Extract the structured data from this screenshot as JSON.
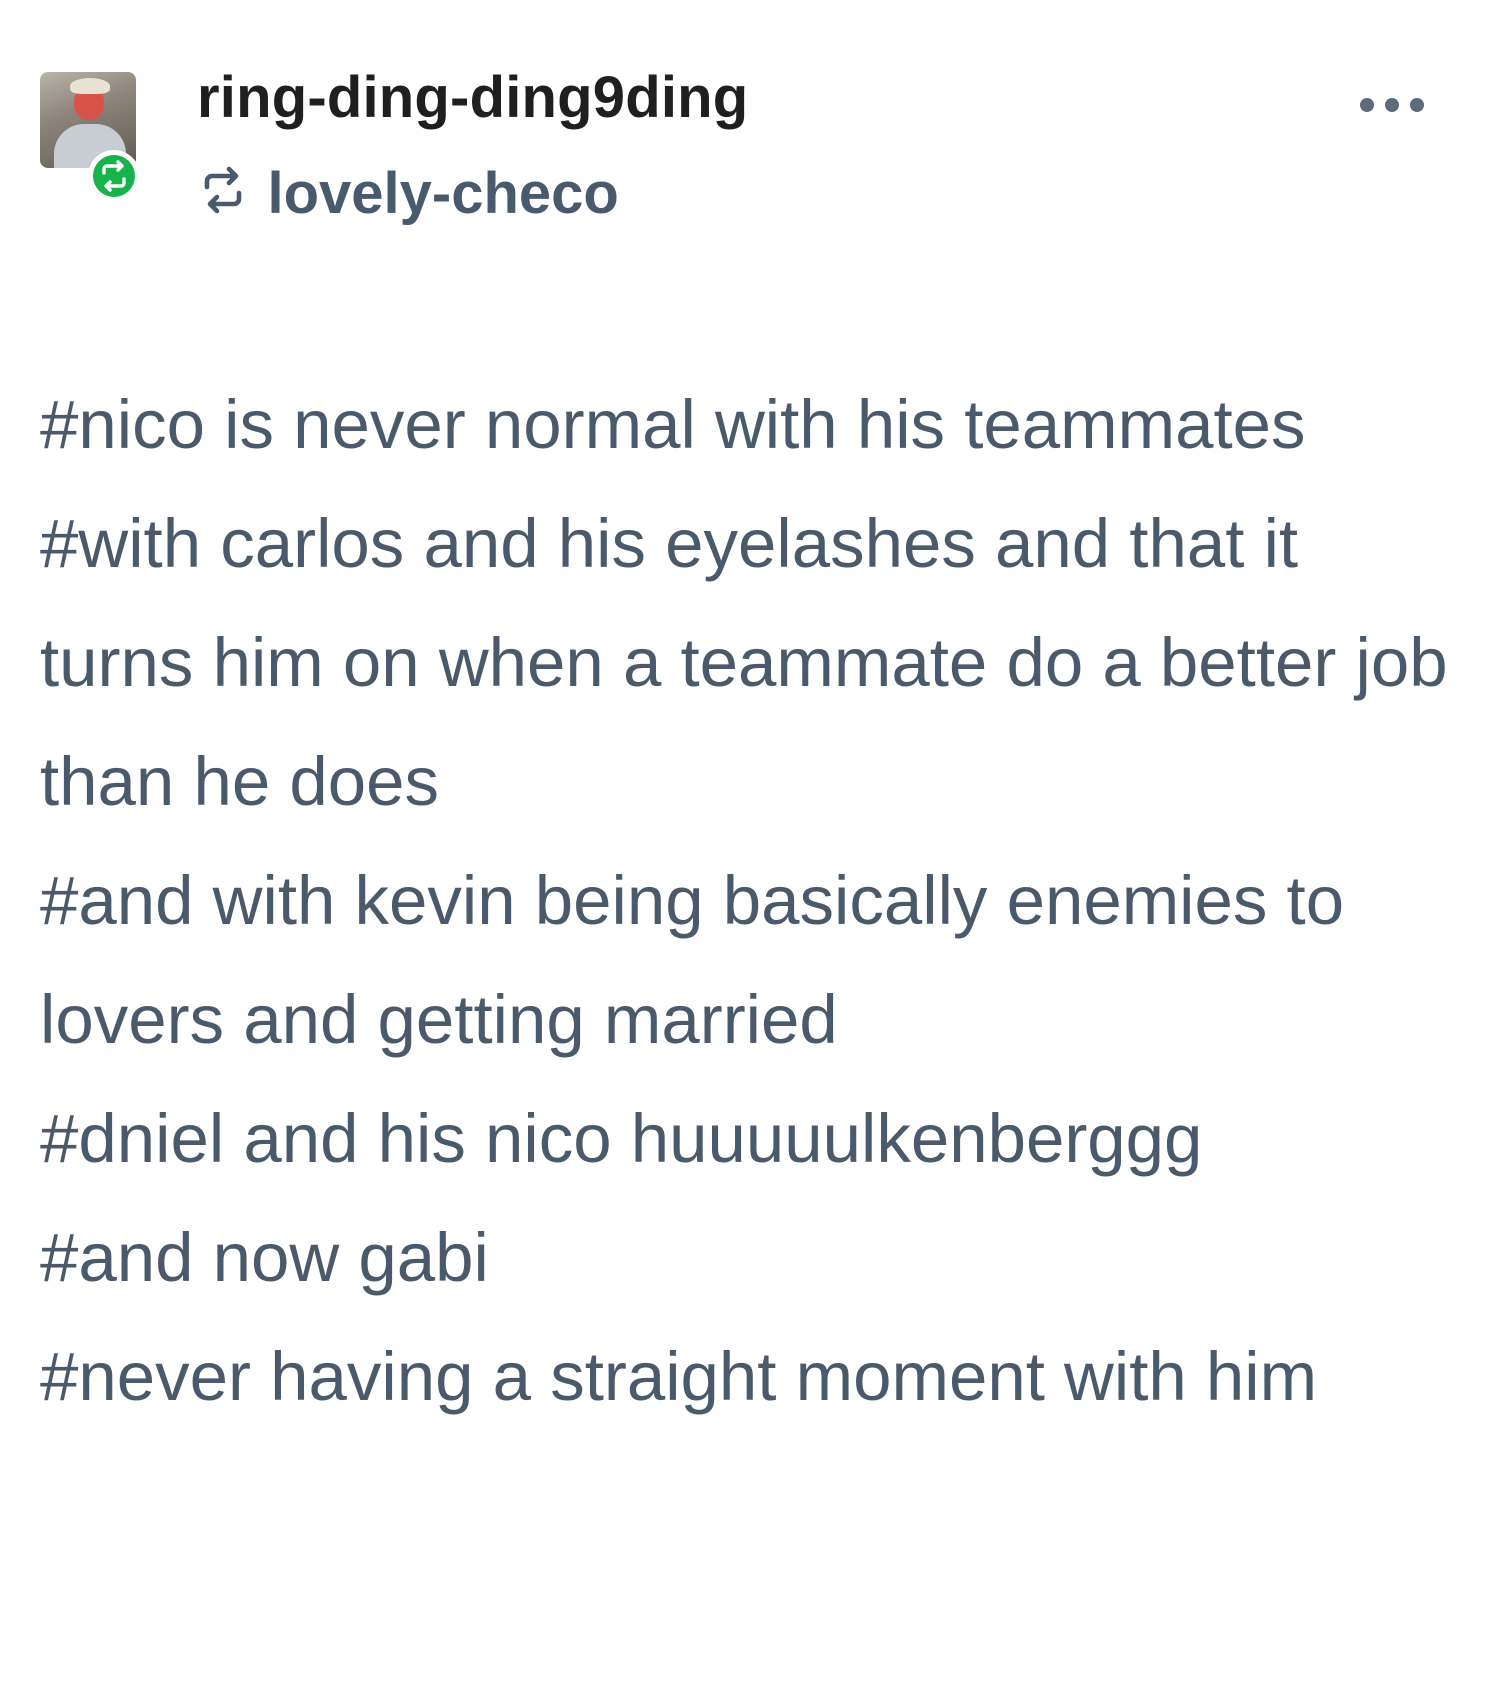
{
  "post": {
    "username": "ring-ding-ding9ding",
    "reblogged_from": "lovely-checo",
    "accent_color": "#16b24a",
    "text_color": "#4b5a6b",
    "avatar_icon": "user-avatar",
    "more_icon": "more-options-icon",
    "reblog_icon": "reblog-icon",
    "tags": [
      "#nico is never normal with his teammates",
      "#with carlos and his eyelashes and that it turns him on when a teammate do a better job than he does",
      "#and with kevin being basically enemies to lovers and getting married",
      "#dniel and his nico huuuuulkenberggg",
      "#and now gabi",
      "#never having a straight moment with him"
    ]
  }
}
